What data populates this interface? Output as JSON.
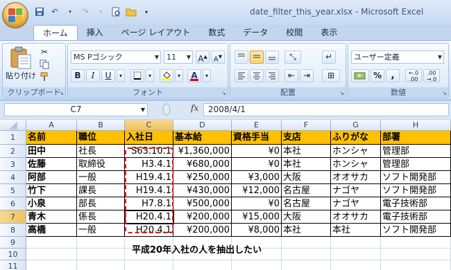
{
  "window": {
    "title": "date_filter_this_year.xlsx - Microsoft Excel"
  },
  "tabs": [
    "ホーム",
    "挿入",
    "ページ レイアウト",
    "数式",
    "データ",
    "校閲",
    "表示"
  ],
  "ribbon": {
    "clipboard": {
      "label": "クリップボード",
      "paste": "貼り付け"
    },
    "font": {
      "label": "フォント",
      "name": "MS Pゴシック",
      "size": "11"
    },
    "alignment": {
      "label": "配置"
    },
    "number": {
      "label": "数値",
      "format": "ユーザー定義"
    }
  },
  "formula_bar": {
    "name_box": "C7",
    "fx": "fx",
    "formula": "2008/4/1"
  },
  "columns": [
    "A",
    "B",
    "C",
    "D",
    "E",
    "F",
    "G",
    "H"
  ],
  "rows": [
    "1",
    "2",
    "3",
    "4",
    "5",
    "6",
    "7",
    "8",
    "9",
    "10",
    "11"
  ],
  "table": {
    "headers": [
      "名前",
      "職位",
      "入社日",
      "基本給",
      "資格手当",
      "支店",
      "ふりがな",
      "部署"
    ],
    "data": [
      [
        "田中",
        "社長",
        "S63.10.1",
        "¥1,360,000",
        "¥0",
        "本社",
        "ホンシャ",
        "管理部"
      ],
      [
        "佐藤",
        "取締役",
        "H3.4.1",
        "¥680,000",
        "¥0",
        "本社",
        "ホンシャ",
        "管理部"
      ],
      [
        "阿部",
        "一般",
        "H19.4.1",
        "¥250,000",
        "¥3,000",
        "大阪",
        "オオサカ",
        "ソフト開発部"
      ],
      [
        "竹下",
        "課長",
        "H19.4.1",
        "¥430,000",
        "¥12,000",
        "名古屋",
        "ナゴヤ",
        "ソフト開発部"
      ],
      [
        "小泉",
        "部長",
        "H7.8.1",
        "¥500,000",
        "¥0",
        "名古屋",
        "ナゴヤ",
        "電子技術部"
      ],
      [
        "青木",
        "係長",
        "H20.4.1",
        "¥200,000",
        "¥15,000",
        "大阪",
        "オオサカ",
        "電子技術部"
      ],
      [
        "高橋",
        "一般",
        "H20.4.1",
        "¥200,000",
        "¥8,000",
        "本社",
        "本社",
        "ソフト開発部"
      ]
    ]
  },
  "annotation": "平成20年入社の人を抽出したい"
}
